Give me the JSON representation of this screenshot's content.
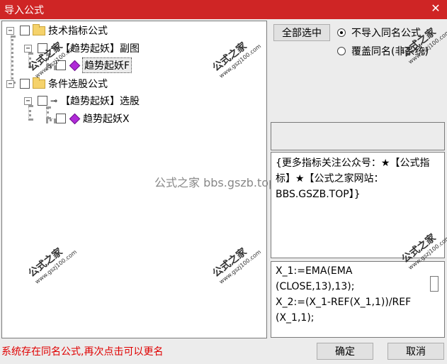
{
  "window": {
    "title": "导入公式",
    "close_glyph": "✕"
  },
  "tree": {
    "groups": [
      {
        "label": "技术指标公式",
        "items": [
          {
            "label": "【趋势起妖】副图",
            "children": [
              {
                "label": "趋势起妖F"
              }
            ]
          }
        ]
      },
      {
        "label": "条件选股公式",
        "items": [
          {
            "label": "【趋势起妖】选股",
            "children": [
              {
                "label": "趋势起妖X"
              }
            ]
          }
        ]
      }
    ],
    "expander_minus": "−"
  },
  "controls": {
    "select_all": "全部选中",
    "radio_no_import": "不导入同名公式",
    "radio_overwrite": "覆盖同名(非系统)",
    "selected_radio": "no_import"
  },
  "description": "{更多指标关注公众号：★【公式指标】★【公式之家网站：BBS.GSZB.TOP】}",
  "code_lines": [
    "X_1:=EMA(EMA",
    "(CLOSE,13),13);",
    "X_2:=(X_1-REF(X_1,1))/REF",
    "(X_1,1);"
  ],
  "status_text": "系统存在同名公式,再次点击可以更名",
  "buttons": {
    "ok": "确定",
    "cancel": "取消"
  },
  "watermark": {
    "title": "公式之家",
    "url": "www.gszj100.com",
    "center_text": "公式之家 bbs.gszb.top"
  },
  "colors": {
    "titlebar": "#cf2525",
    "status": "#e00000",
    "gem": "#b02ad8"
  }
}
